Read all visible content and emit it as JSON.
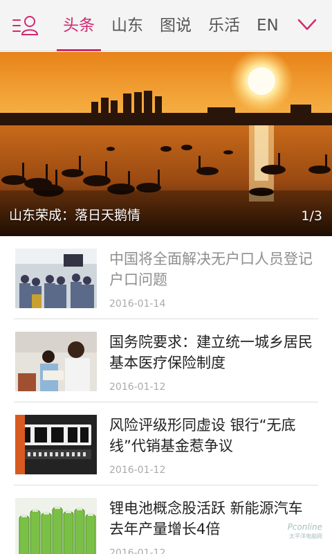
{
  "nav": {
    "tabs": [
      {
        "label": "头条",
        "active": true
      },
      {
        "label": "山东",
        "active": false
      },
      {
        "label": "图说",
        "active": false
      },
      {
        "label": "乐活",
        "active": false
      },
      {
        "label": "EN",
        "active": false
      }
    ],
    "user_icon": "user-menu-icon",
    "more_icon": "chevron-down-icon",
    "accent_color": "#d0296f"
  },
  "hero": {
    "caption": "山东荣成：落日天鹅情",
    "counter": "1/3"
  },
  "articles": [
    {
      "title": "中国将全面解决无户口人员登记户口问题",
      "date": "2016-01-14",
      "read": true
    },
    {
      "title": "国务院要求：建立统一城乡居民基本医疗保险制度",
      "date": "2016-01-12",
      "read": false
    },
    {
      "title": "风险评级形同虚设 银行“无底线”代销基金惹争议",
      "date": "2016-01-12",
      "read": false
    },
    {
      "title": "锂电池概念股活跃 新能源汽车去年产量增长4倍",
      "date": "2016-01-12",
      "read": false
    }
  ],
  "watermark": {
    "text": "Pconline",
    "sub": "太平洋电脑网"
  }
}
